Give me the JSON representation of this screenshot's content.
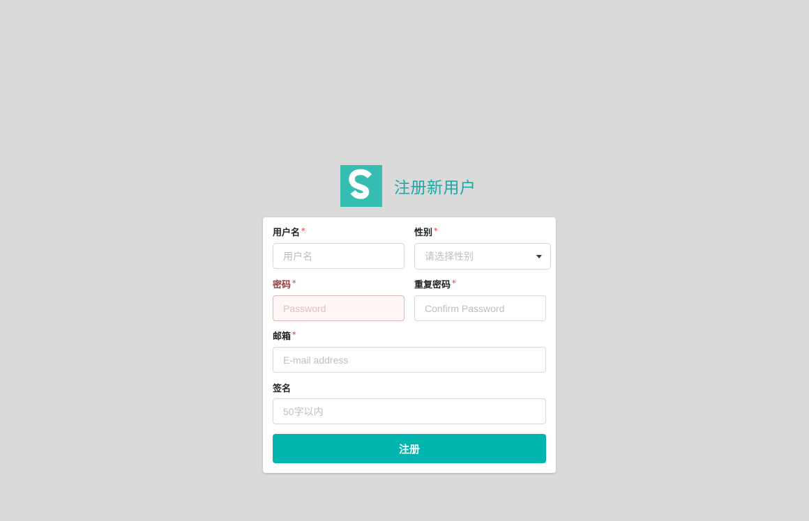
{
  "header": {
    "logo_letter": "S",
    "title": "注册新用户",
    "logo_color": "#35bdb2",
    "title_color": "#19a9a7"
  },
  "form": {
    "username": {
      "label": "用户名",
      "required_mark": "*",
      "placeholder": "用户名",
      "value": ""
    },
    "gender": {
      "label": "性别",
      "required_mark": "*",
      "placeholder": "请选择性别"
    },
    "password": {
      "label": "密码",
      "required_mark": "*",
      "placeholder": "Password",
      "value": "",
      "state": "error"
    },
    "confirm_password": {
      "label": "重复密码",
      "required_mark": "*",
      "placeholder": "Confirm Password",
      "value": ""
    },
    "email": {
      "label": "邮箱",
      "required_mark": "*",
      "placeholder": "E-mail address",
      "value": ""
    },
    "signature": {
      "label": "签名",
      "placeholder": "50字以内",
      "value": ""
    },
    "submit_label": "注册",
    "submit_color": "#00b5ad",
    "error_color": "#db2828"
  }
}
